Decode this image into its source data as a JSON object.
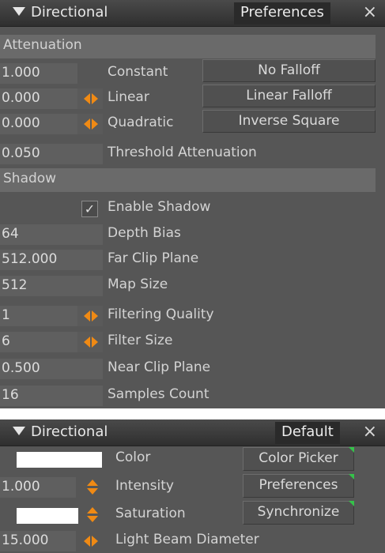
{
  "panel1": {
    "title": "Directional",
    "tab": "Preferences",
    "close": "×",
    "attenuation": {
      "header": "Attenuation",
      "rows": [
        {
          "value": "1.000",
          "label": "Constant"
        },
        {
          "value": "0.000",
          "label": "Linear"
        },
        {
          "value": "0.000",
          "label": "Quadratic"
        },
        {
          "value": "0.050",
          "label": "Threshold Attenuation"
        }
      ],
      "buttons": [
        "No Falloff",
        "Linear Falloff",
        "Inverse Square"
      ]
    },
    "shadow": {
      "header": "Shadow",
      "enable_label": "Enable Shadow",
      "enable_checked": "✓",
      "rows": [
        {
          "value": "64",
          "label": "Depth Bias"
        },
        {
          "value": "512.000",
          "label": "Far Clip Plane"
        },
        {
          "value": "512",
          "label": "Map Size"
        },
        {
          "value": "1",
          "label": "Filtering Quality"
        },
        {
          "value": "6",
          "label": "Filter Size"
        },
        {
          "value": "0.500",
          "label": "Near Clip Plane"
        },
        {
          "value": "16",
          "label": "Samples Count"
        }
      ]
    }
  },
  "panel2": {
    "title": "Directional",
    "tab": "Default",
    "close": "×",
    "rows": [
      {
        "label": "Color",
        "swatch_color": "#ffffff"
      },
      {
        "value": "1.000",
        "label": "Intensity"
      },
      {
        "label": "Saturation",
        "swatch_color": "#ffffff"
      },
      {
        "value": "15.000",
        "label": "Light Beam Diameter"
      }
    ],
    "buttons": [
      "Color Picker",
      "Preferences",
      "Synchronize"
    ]
  },
  "colors": {
    "panel_bg": "#565656",
    "section_bg": "#6a6a6a",
    "accent_orange": "#f08a14",
    "corner_green": "#35c24a"
  }
}
